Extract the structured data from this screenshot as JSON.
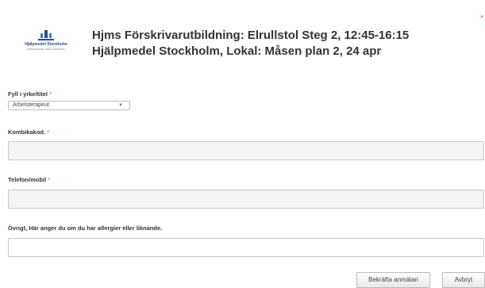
{
  "logo": {
    "name": "Hjälpmedel Stockholm",
    "sub": "STOCKHOLMS LÄNS LANDSTING"
  },
  "heading": {
    "line1": "Hjms Förskrivarutbildning: Elrullstol Steg 2, 12:45-16:15",
    "line2": "Hjälpmedel Stockholm, Lokal: Måsen plan 2, 24 apr"
  },
  "corner_marker": "*",
  "form": {
    "title_label": "Fyll i yrke/titel",
    "title_value": "Arbetsterapeut",
    "code_label": "Kombikakod.",
    "phone_label": "Telefon/mobil",
    "other_label": "Övrigt, Här anger du om du har allergier eller liknande.",
    "required_mark": "*"
  },
  "buttons": {
    "confirm": "Bekräfta anmälan",
    "cancel": "Avbryt"
  },
  "colors": {
    "brand": "#2a4d8f",
    "required": "#e05050"
  }
}
